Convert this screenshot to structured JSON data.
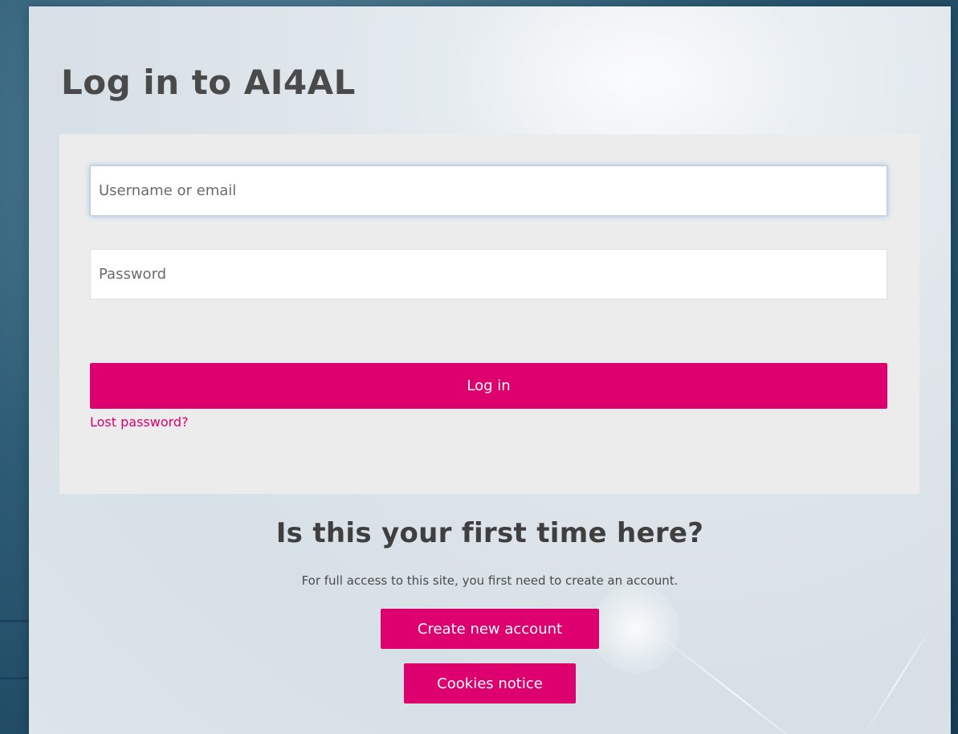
{
  "login": {
    "title": "Log in to AI4AL",
    "username_placeholder": "Username or email",
    "password_placeholder": "Password",
    "login_button_label": "Log in",
    "lost_password_label": "Lost password?"
  },
  "signup": {
    "heading": "Is this your first time here?",
    "description": "For full access to this site, you first need to create an account.",
    "create_account_label": "Create new account",
    "cookies_label": "Cookies notice"
  },
  "colors": {
    "accent": "#de006e",
    "card_background": "#ececec",
    "title_text": "#4a4a4a"
  }
}
